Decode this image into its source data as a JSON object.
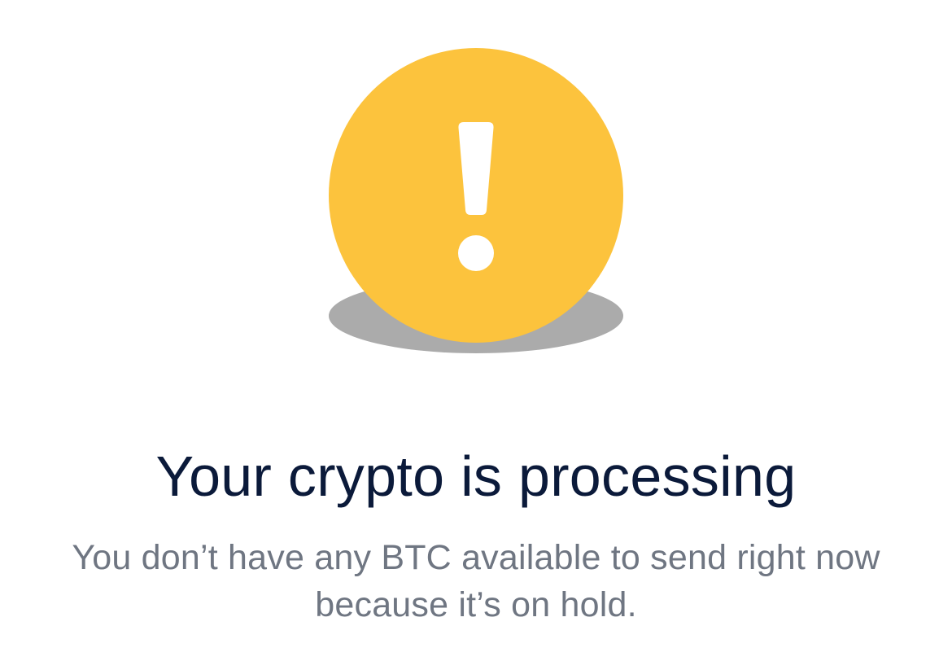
{
  "status": {
    "icon": "exclamation-warning-icon",
    "colors": {
      "circle": "#FCC33D",
      "shadow": "#ABABAB",
      "mark": "#FFFFFF",
      "title": "#0B1A3A",
      "message": "#6F7682",
      "background": "#FFFFFF"
    },
    "title": "Your crypto is processing",
    "message": "You don’t have any BTC available to send right now because it’s on hold."
  }
}
